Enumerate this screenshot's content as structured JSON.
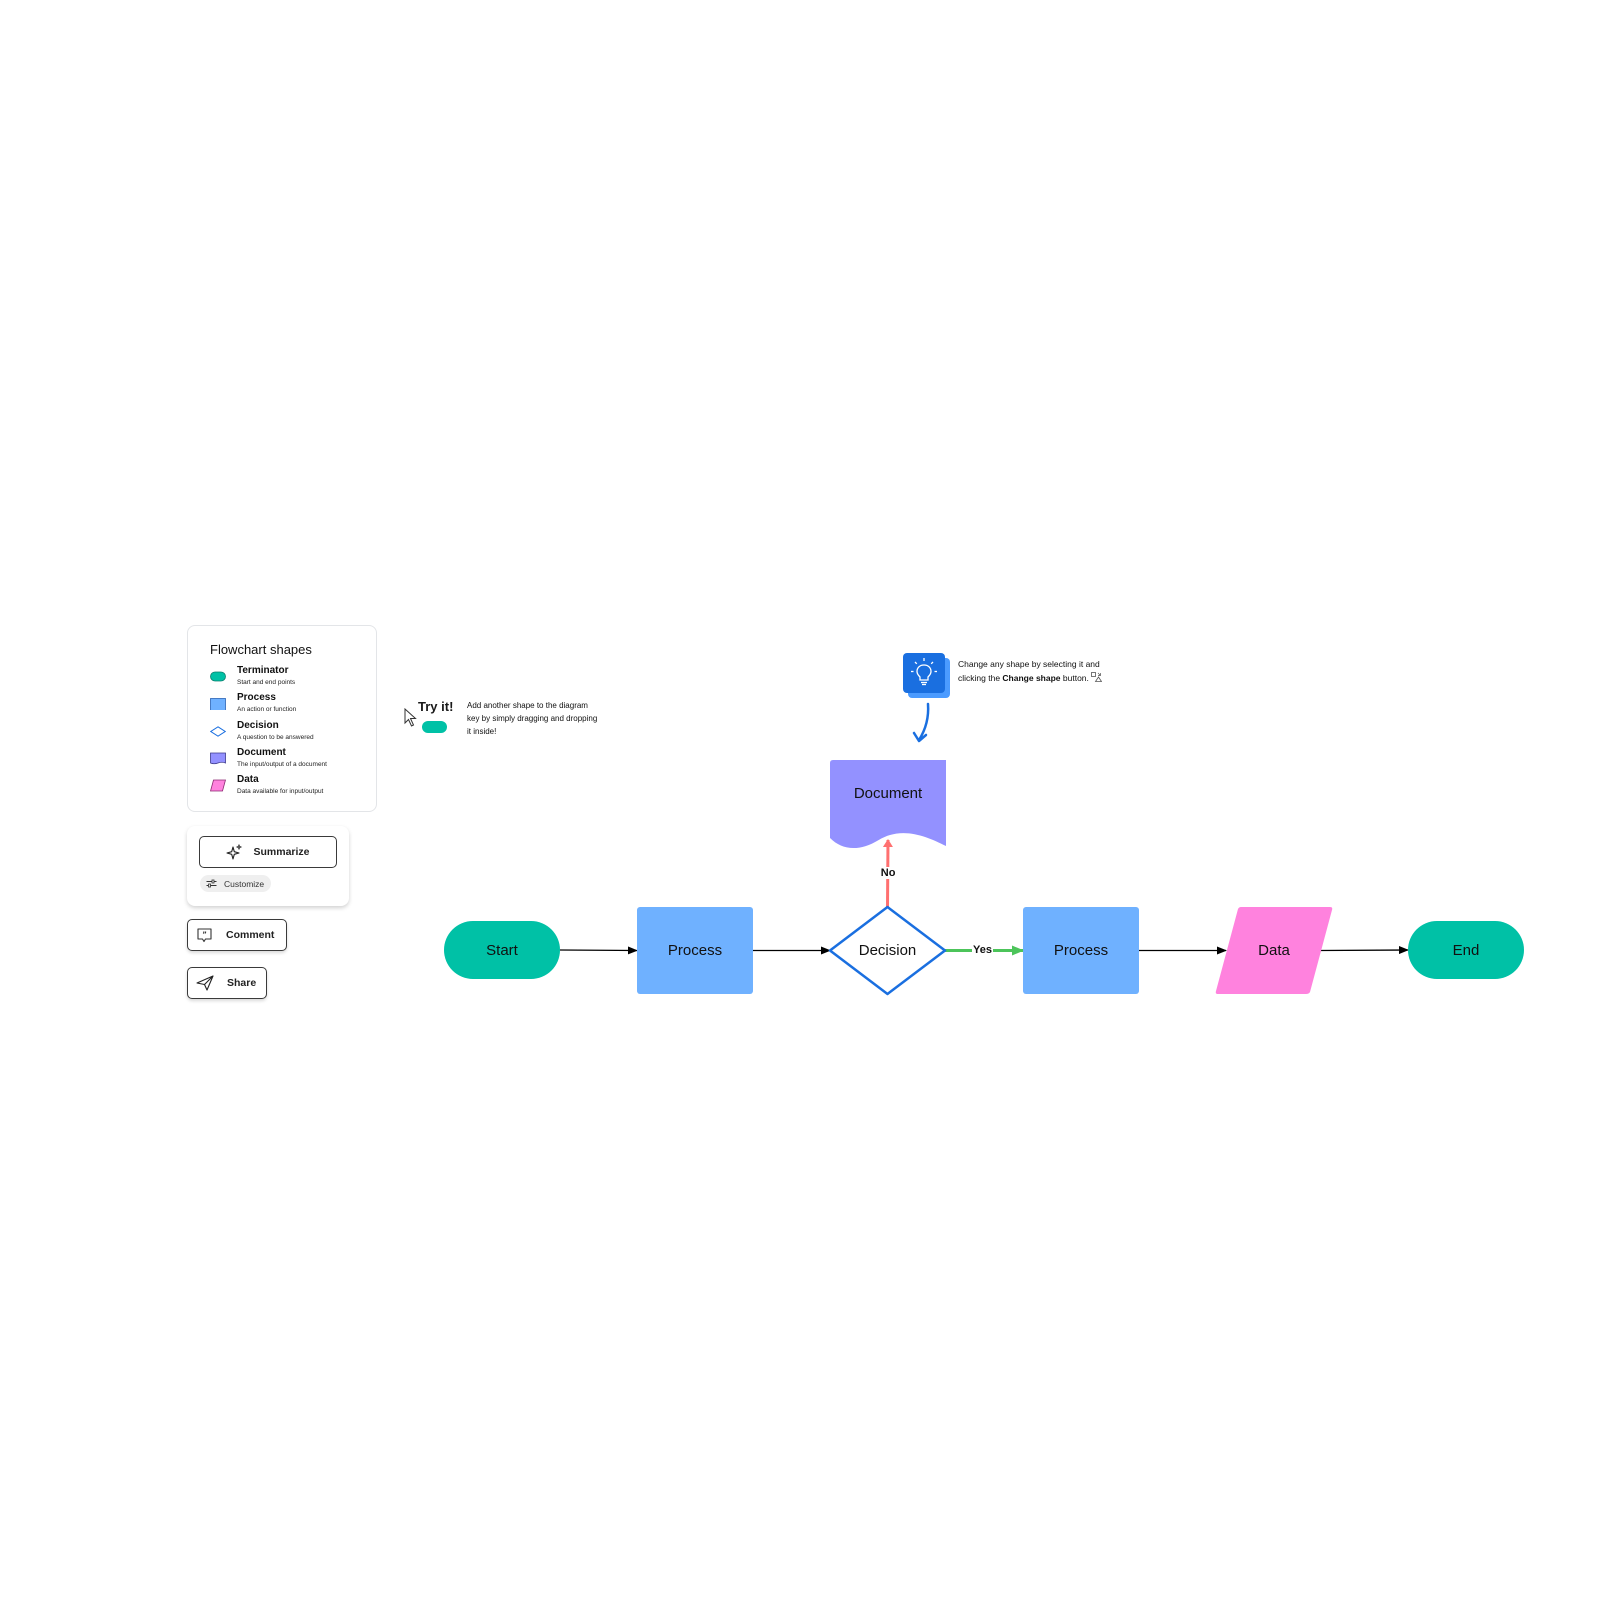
{
  "legend": {
    "title": "Flowchart shapes",
    "items": [
      {
        "name": "Terminator",
        "description": "Start and end points",
        "shape": "terminator",
        "color": "#00c1a6"
      },
      {
        "name": "Process",
        "description": "An action or function",
        "shape": "process",
        "color": "#6fb1ff"
      },
      {
        "name": "Decision",
        "description": "A question to be answered",
        "shape": "decision",
        "color": "#1a6fe0"
      },
      {
        "name": "Document",
        "description": "The input/output of a document",
        "shape": "document",
        "color": "#9391ff"
      },
      {
        "name": "Data",
        "description": "Data available for input/output",
        "shape": "data",
        "color": "#ff82de"
      }
    ]
  },
  "actions": {
    "summarize_label": "Summarize",
    "summarize_icon": "sparkle-icon",
    "customize_label": "Customize",
    "customize_icon": "sliders-icon",
    "comment_label": "Comment",
    "comment_icon": "comment-quote-icon",
    "share_label": "Share",
    "share_icon": "paper-plane-icon"
  },
  "try_it": {
    "title": "Try it!",
    "text": "Add another shape to the diagram key by simply dragging and dropping it inside!"
  },
  "tip": {
    "icon": "lightbulb-icon",
    "line1": "Change any shape by selecting it and",
    "line2_prefix": "clicking the ",
    "line2_bold": "Change shape",
    "line2_suffix": " button."
  },
  "flowchart": {
    "nodes": [
      {
        "id": "start",
        "label": "Start",
        "shape": "terminator",
        "color": "#00c1a6"
      },
      {
        "id": "process1",
        "label": "Process",
        "shape": "process",
        "color": "#6fb1ff"
      },
      {
        "id": "decision",
        "label": "Decision",
        "shape": "decision",
        "color": "#1a6fe0"
      },
      {
        "id": "document",
        "label": "Document",
        "shape": "document",
        "color": "#9391ff"
      },
      {
        "id": "process2",
        "label": "Process",
        "shape": "process",
        "color": "#6fb1ff"
      },
      {
        "id": "data",
        "label": "Data",
        "shape": "data",
        "color": "#ff82de"
      },
      {
        "id": "end",
        "label": "End",
        "shape": "terminator",
        "color": "#00c1a6"
      }
    ],
    "edges": [
      {
        "from": "start",
        "to": "process1",
        "label": "",
        "color": "#000000"
      },
      {
        "from": "process1",
        "to": "decision",
        "label": "",
        "color": "#000000"
      },
      {
        "from": "decision",
        "to": "document",
        "label": "No",
        "color": "#ff7070"
      },
      {
        "from": "decision",
        "to": "process2",
        "label": "Yes",
        "color": "#4cc45a"
      },
      {
        "from": "process2",
        "to": "data",
        "label": "",
        "color": "#000000"
      },
      {
        "from": "data",
        "to": "end",
        "label": "",
        "color": "#000000"
      }
    ]
  }
}
